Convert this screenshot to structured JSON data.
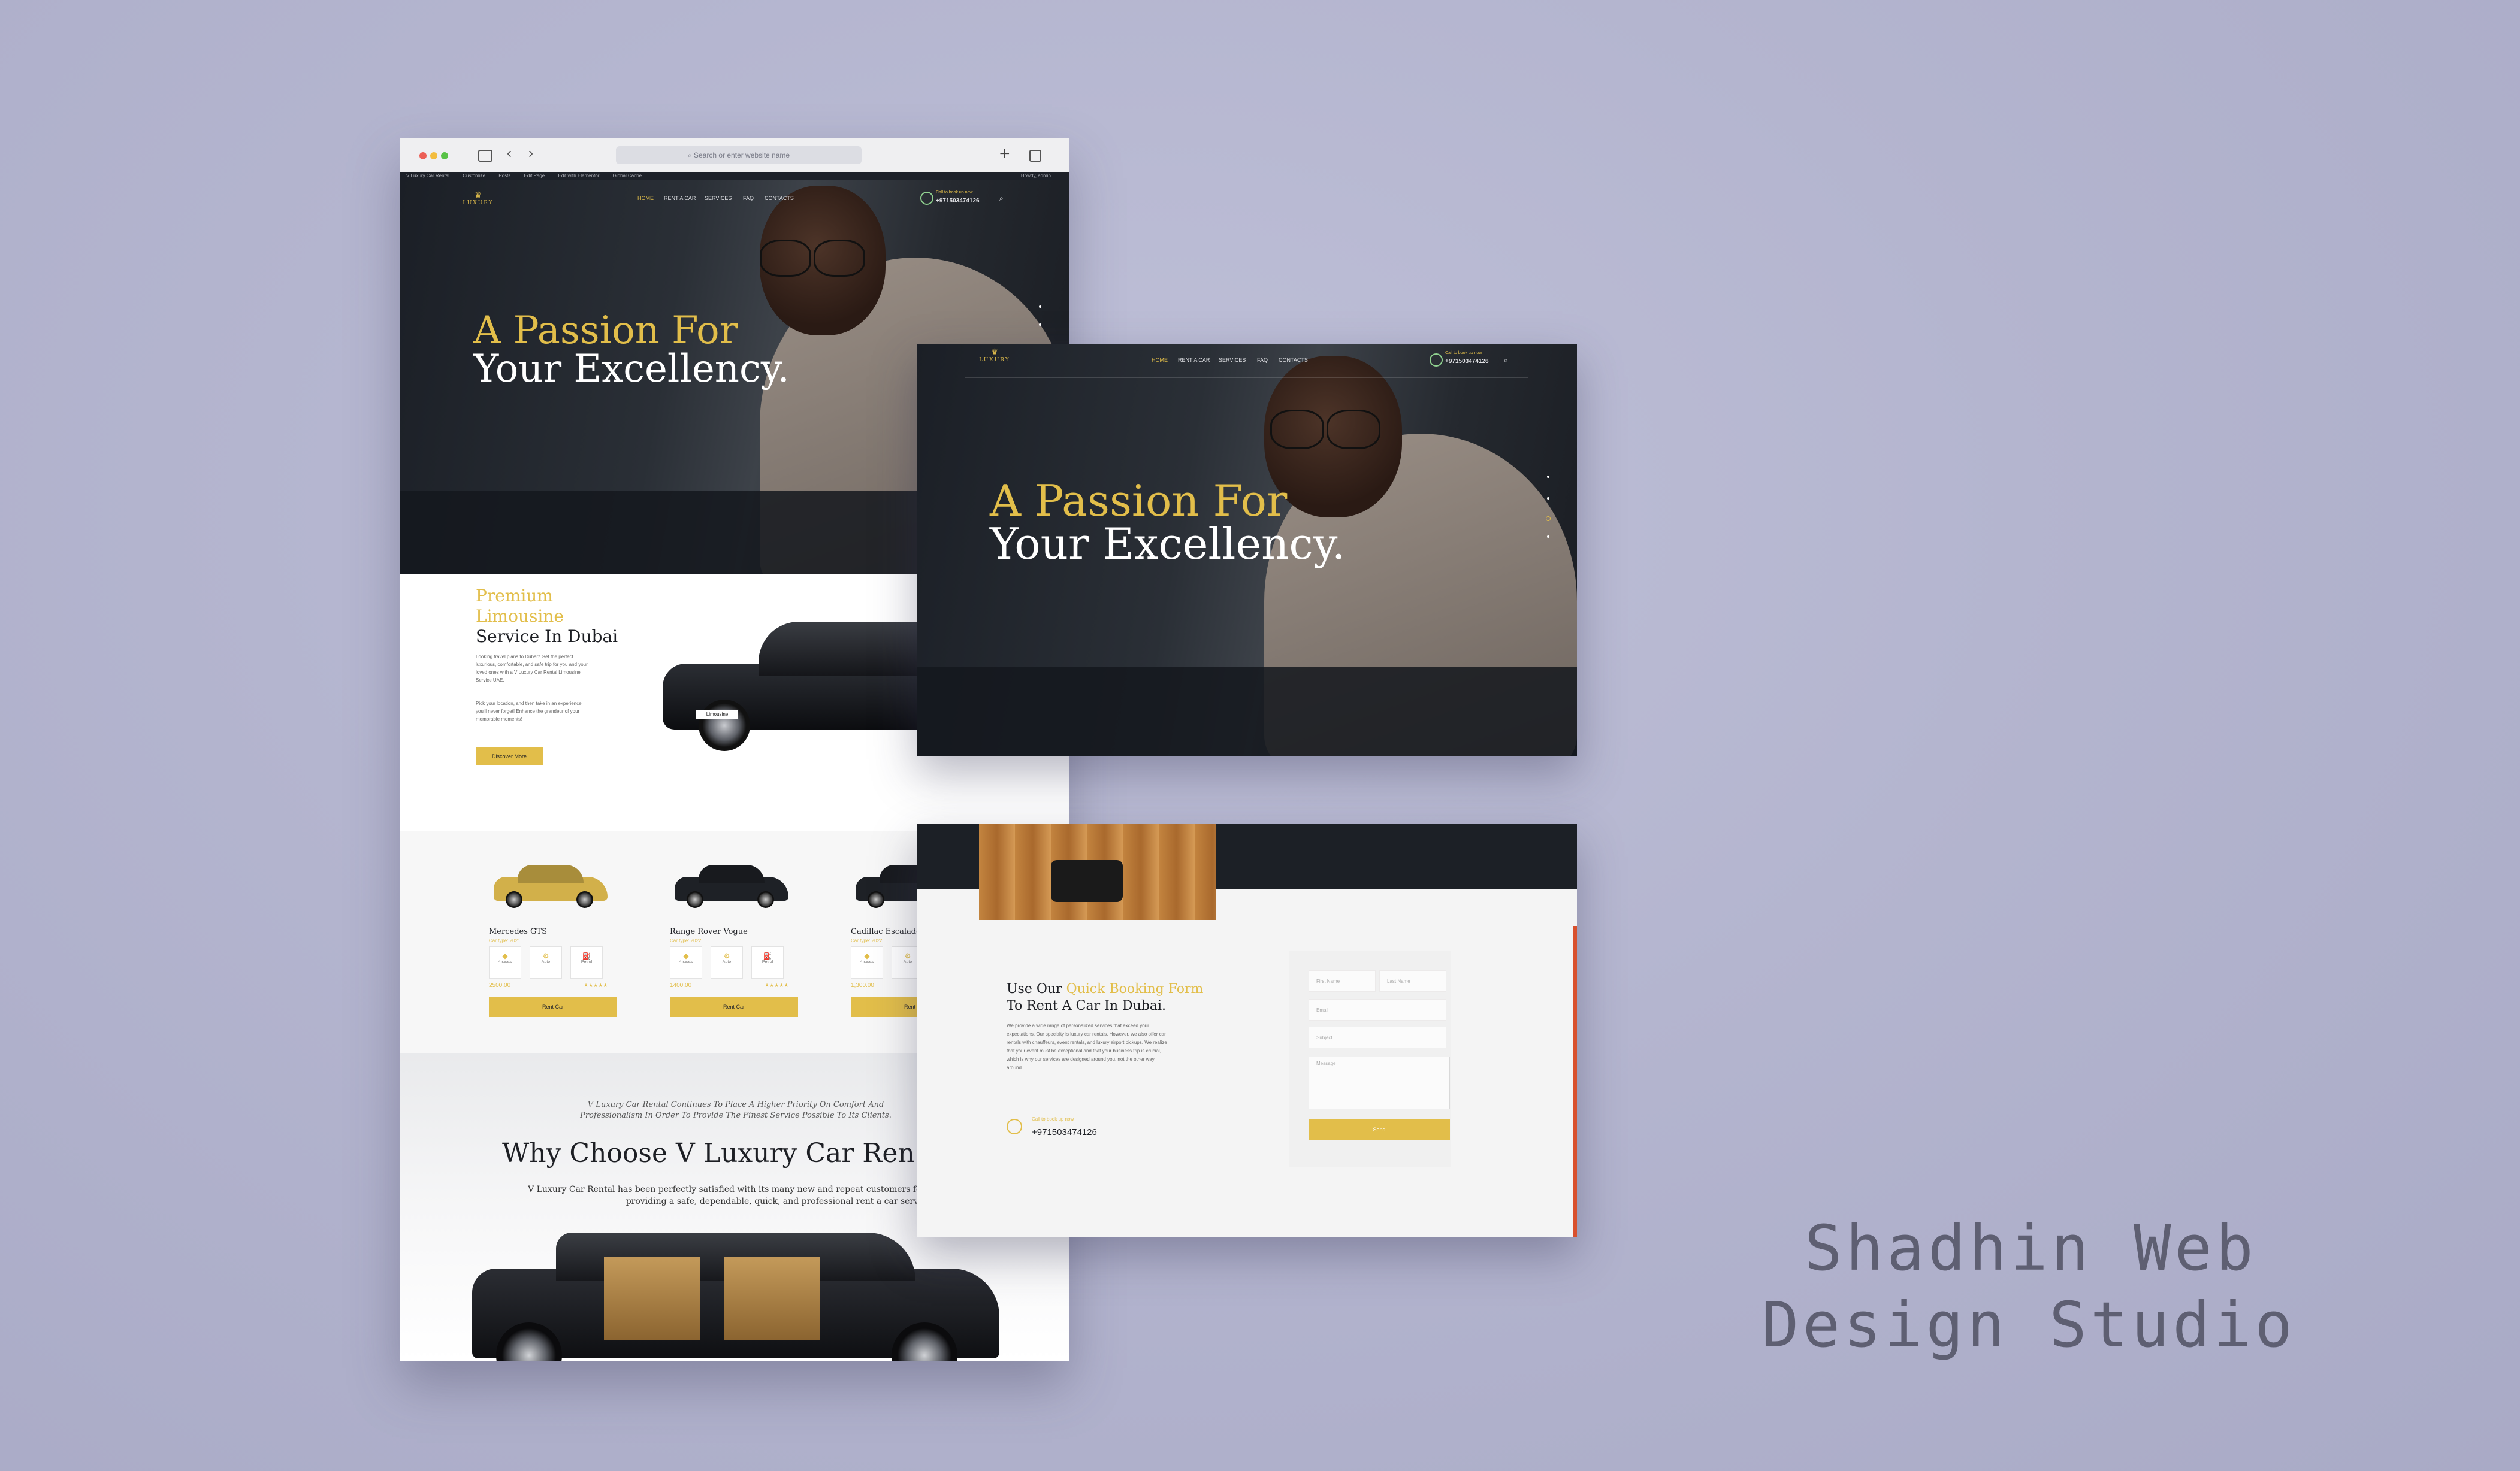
{
  "browser": {
    "url_placeholder": "Search or enter website name",
    "bookmarks": [
      "V Luxury Car Rental",
      "Customize",
      "Posts",
      "Edit Page",
      "Edit with Elementor",
      "Global Cache"
    ],
    "bookmark_right": "Howdy, admin"
  },
  "nav": {
    "logo": "LUXURY",
    "items": [
      "HOME",
      "RENT A CAR",
      "SERVICES",
      "FAQ",
      "CONTACTS"
    ],
    "call_label": "Call to book up now",
    "phone": "+971503474126"
  },
  "hero": {
    "line1": "A Passion For",
    "line2": "Your Excellency."
  },
  "premium": {
    "title_gold_1": "Premium",
    "title_gold_2": "Limousine",
    "title_dark": "Service In Dubai",
    "para1": "Looking travel plans to Dubai? Get the perfect luxurious, comfortable, and safe trip for you and your loved ones with a V Luxury Car Rental Limousine Service UAE.",
    "para2": "Pick your location, and then take in an experience you'll never forget! Enhance the grandeur of your memorable moments!",
    "button": "Discover More",
    "car_tag": "Limousine"
  },
  "cars": [
    {
      "name": "Mercedes GTS",
      "sub": "Car type: 2021",
      "price": "2500.00",
      "color": "#d2b04a"
    },
    {
      "name": "Range Rover Vogue",
      "sub": "Car type: 2022",
      "price": "1400.00",
      "color": "#1e2126"
    },
    {
      "name": "Cadillac Escalade",
      "sub": "Car type: 2022",
      "price": "1,300.00",
      "color": "#1e2126"
    }
  ],
  "car_specs": [
    "4 seats",
    "Auto",
    "Petrol"
  ],
  "rating": "★★★★★",
  "rent_label": "Rent Car",
  "why": {
    "intro": "V Luxury Car Rental Continues To Place A Higher Priority On Comfort And Professionalism In Order To Provide The Finest Service Possible To Its Clients.",
    "title": "Why Choose V Luxury Car Ren",
    "body": "V Luxury Car Rental has been perfectly satisfied with its many new and repeat customers for the past We take pleasure in providing a safe, dependable, quick, and professional rent a car service in D"
  },
  "booking": {
    "prefix": "Use Our ",
    "gold": "Quick Booking Form",
    "line2": "To Rent A Car In Dubai.",
    "para": "We provide a wide range of personalized services that exceed your expectations. Our specialty is luxury car rentals. However, we also offer car rentals with chauffeurs, event rentals, and luxury airport pickups. We realize that your event must be exceptional and that your business trip is crucial, which is why our services are designed around you, not the other way around.",
    "call_label": "Call to book up now",
    "phone": "+971503474126",
    "fields": {
      "first": "First Name",
      "last": "Last Name",
      "email": "Email",
      "subject": "Subject",
      "message": "Message"
    },
    "send": "Send"
  },
  "studio": {
    "line1": "Shadhin Web",
    "line2": "Design Studio"
  },
  "colors": {
    "gold": "#e2be4a",
    "dark": "#1c2026",
    "background": "#b4b5cf"
  }
}
